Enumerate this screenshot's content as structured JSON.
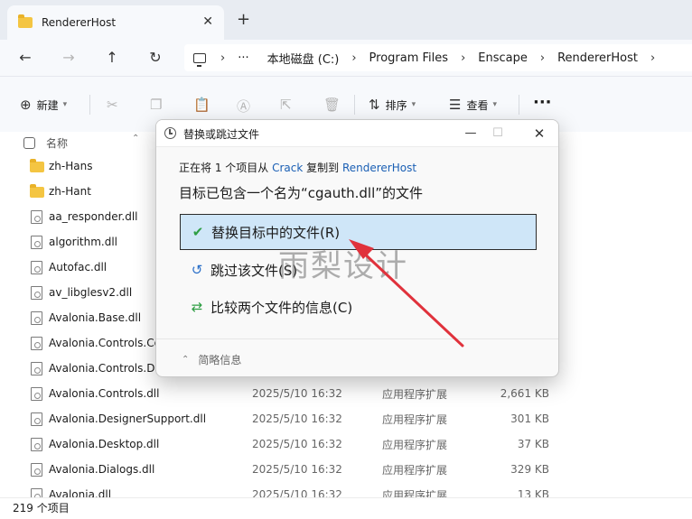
{
  "tab": {
    "title": "RendererHost",
    "close": "✕",
    "add": "+"
  },
  "nav": {
    "back": "←",
    "forward": "→",
    "up": "↑",
    "refresh": "↻"
  },
  "address": {
    "more": "···",
    "sep": "›",
    "crumbs": [
      "本地磁盘 (C:)",
      "Program Files",
      "Enscape",
      "RendererHost"
    ]
  },
  "commands": {
    "new_label": "新建",
    "sort_label": "排序",
    "view_label": "查看",
    "more": "···"
  },
  "list_header": {
    "name": "名称"
  },
  "files": [
    {
      "name": "zh-Hans",
      "type": "folder",
      "date": "",
      "kind": "",
      "size": ""
    },
    {
      "name": "zh-Hant",
      "type": "folder",
      "date": "",
      "kind": "",
      "size": ""
    },
    {
      "name": "aa_responder.dll",
      "type": "file",
      "date": "",
      "kind": "",
      "size": ""
    },
    {
      "name": "algorithm.dll",
      "type": "file",
      "date": "",
      "kind": "",
      "size": ""
    },
    {
      "name": "Autofac.dll",
      "type": "file",
      "date": "",
      "kind": "",
      "size": ""
    },
    {
      "name": "av_libglesv2.dll",
      "type": "file",
      "date": "",
      "kind": "",
      "size": ""
    },
    {
      "name": "Avalonia.Base.dll",
      "type": "file",
      "date": "",
      "kind": "",
      "size": ""
    },
    {
      "name": "Avalonia.Controls.Co",
      "type": "file",
      "date": "",
      "kind": "",
      "size": ""
    },
    {
      "name": "Avalonia.Controls.Da",
      "type": "file",
      "date": "",
      "kind": "",
      "size": ""
    },
    {
      "name": "Avalonia.Controls.dll",
      "type": "file",
      "date": "2025/5/10 16:32",
      "kind": "应用程序扩展",
      "size": "2,661 KB"
    },
    {
      "name": "Avalonia.DesignerSupport.dll",
      "type": "file",
      "date": "2025/5/10 16:32",
      "kind": "应用程序扩展",
      "size": "301 KB"
    },
    {
      "name": "Avalonia.Desktop.dll",
      "type": "file",
      "date": "2025/5/10 16:32",
      "kind": "应用程序扩展",
      "size": "37 KB"
    },
    {
      "name": "Avalonia.Dialogs.dll",
      "type": "file",
      "date": "2025/5/10 16:32",
      "kind": "应用程序扩展",
      "size": "329 KB"
    },
    {
      "name": "Avalonia.dll",
      "type": "file",
      "date": "2025/5/10 16:32",
      "kind": "应用程序扩展",
      "size": "13 KB"
    }
  ],
  "status": {
    "count": "219 个项目"
  },
  "dialog": {
    "title": "替换或跳过文件",
    "line1_prefix": "正在将 1 个项目从 ",
    "line1_source": "Crack",
    "line1_mid": " 复制到 ",
    "line1_dest": "RendererHost",
    "line2": "目标已包含一个名为“cgauth.dll”的文件",
    "option_replace": "替换目标中的文件(R)",
    "option_skip": "跳过该文件(S)",
    "option_compare": "比较两个文件的信息(C)",
    "details": "简略信息"
  },
  "watermark": "雨梨设计",
  "colors": {
    "accent": "#1a5fb4",
    "selected_bg": "#cfe6f8",
    "arrow": "#e0323c",
    "folder": "#f4c542"
  }
}
